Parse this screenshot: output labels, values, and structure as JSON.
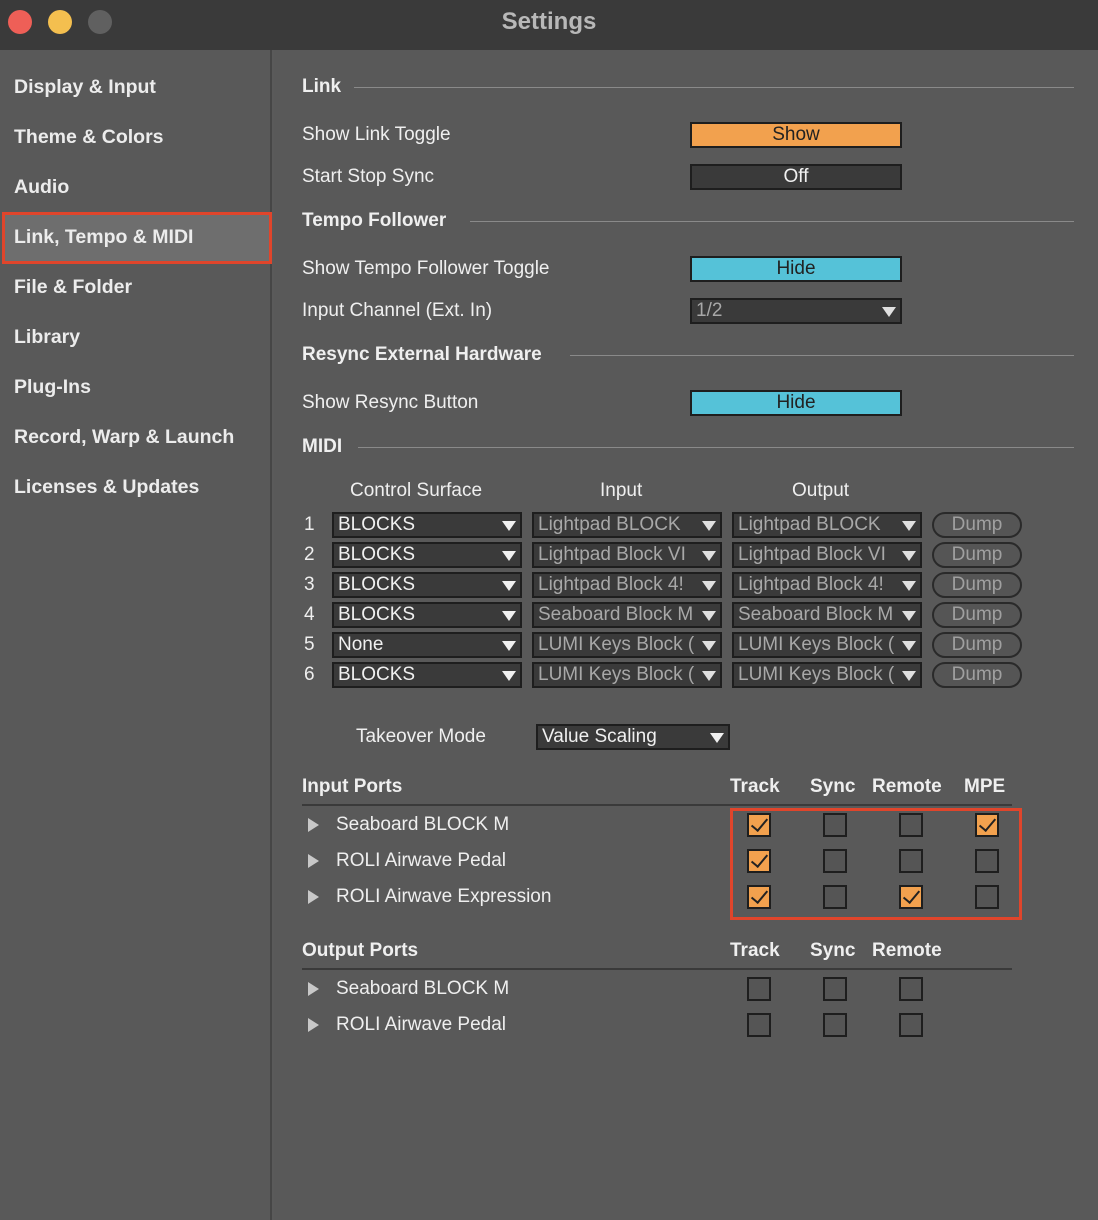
{
  "window": {
    "title": "Settings"
  },
  "sidebar": {
    "items": [
      {
        "label": "Display & Input"
      },
      {
        "label": "Theme & Colors"
      },
      {
        "label": "Audio"
      },
      {
        "label": "Link, Tempo & MIDI",
        "selected": true
      },
      {
        "label": "File & Folder"
      },
      {
        "label": "Library"
      },
      {
        "label": "Plug-Ins"
      },
      {
        "label": "Record, Warp & Launch"
      },
      {
        "label": "Licenses & Updates"
      }
    ]
  },
  "link": {
    "title": "Link",
    "show_link_toggle": {
      "label": "Show Link Toggle",
      "value": "Show"
    },
    "start_stop_sync": {
      "label": "Start Stop Sync",
      "value": "Off"
    }
  },
  "tempo_follower": {
    "title": "Tempo Follower",
    "show_toggle": {
      "label": "Show Tempo Follower Toggle",
      "value": "Hide"
    },
    "input_channel": {
      "label": "Input Channel (Ext. In)",
      "value": "1/2"
    }
  },
  "resync": {
    "title": "Resync External Hardware",
    "show_button": {
      "label": "Show Resync Button",
      "value": "Hide"
    }
  },
  "midi": {
    "title": "MIDI",
    "headers": {
      "control_surface": "Control Surface",
      "input": "Input",
      "output": "Output"
    },
    "dump_label": "Dump",
    "rows": [
      {
        "num": "1",
        "surface": "BLOCKS",
        "input": "Lightpad BLOCK",
        "output": "Lightpad BLOCK"
      },
      {
        "num": "2",
        "surface": "BLOCKS",
        "input": "Lightpad Block VI",
        "output": "Lightpad Block VI"
      },
      {
        "num": "3",
        "surface": "BLOCKS",
        "input": "Lightpad Block 4!",
        "output": "Lightpad Block 4!"
      },
      {
        "num": "4",
        "surface": "BLOCKS",
        "input": "Seaboard Block M",
        "output": "Seaboard Block M"
      },
      {
        "num": "5",
        "surface": "None",
        "input": "LUMI Keys Block (",
        "output": "LUMI Keys Block ("
      },
      {
        "num": "6",
        "surface": "BLOCKS",
        "input": "LUMI Keys Block (",
        "output": "LUMI Keys Block ("
      }
    ],
    "takeover": {
      "label": "Takeover Mode",
      "value": "Value Scaling"
    }
  },
  "input_ports": {
    "title": "Input Ports",
    "columns": [
      "Track",
      "Sync",
      "Remote",
      "MPE"
    ],
    "ports": [
      {
        "name": "Seaboard BLOCK M",
        "track": true,
        "sync": false,
        "remote": false,
        "mpe": true
      },
      {
        "name": "ROLI Airwave Pedal",
        "track": true,
        "sync": false,
        "remote": false,
        "mpe": false
      },
      {
        "name": "ROLI Airwave Expression",
        "track": true,
        "sync": false,
        "remote": true,
        "mpe": false
      }
    ]
  },
  "output_ports": {
    "title": "Output Ports",
    "columns": [
      "Track",
      "Sync",
      "Remote"
    ],
    "ports": [
      {
        "name": "Seaboard BLOCK M",
        "track": false,
        "sync": false,
        "remote": false
      },
      {
        "name": "ROLI Airwave Pedal",
        "track": false,
        "sync": false,
        "remote": false
      }
    ]
  }
}
